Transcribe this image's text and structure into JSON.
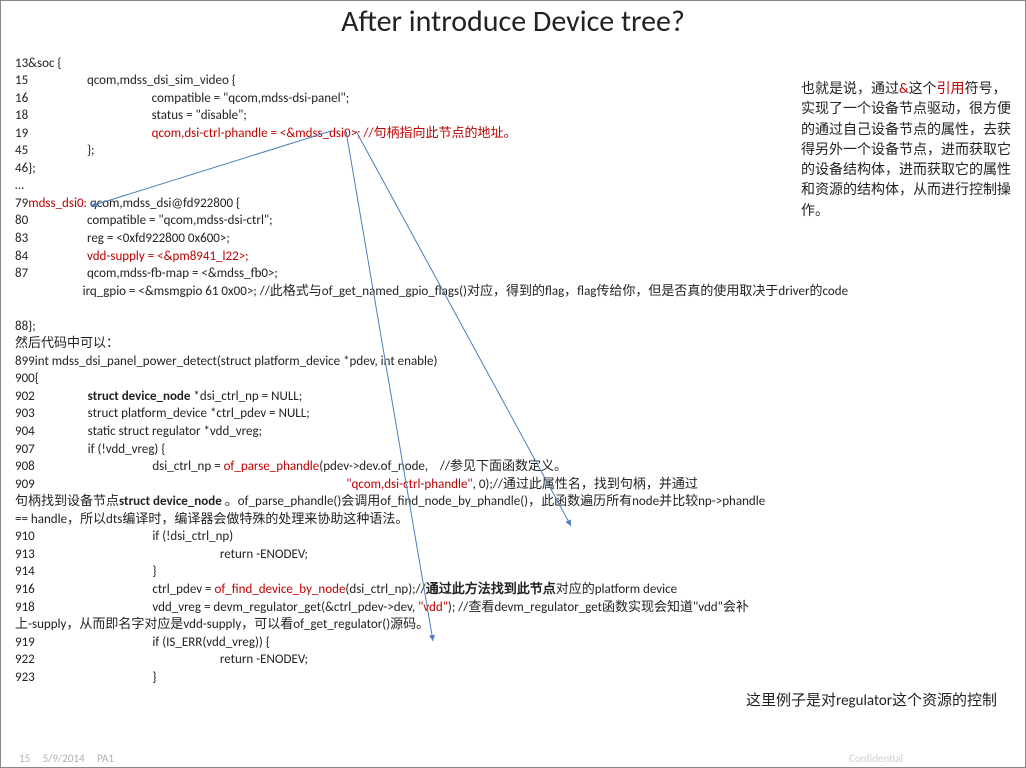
{
  "title": "After introduce Device tree?",
  "code": {
    "l13": "13&soc {",
    "l15": "15                    qcom,mdss_dsi_sim_video {",
    "l16": "16                                          compatible = \"qcom,mdss-dsi-panel\";",
    "l18": "18                                          status = \"disable\";",
    "l19pfx": "19                                          ",
    "l19red": "qcom,dsi-ctrl-phandle = <&mdss_dsi0>; //句柄指向此节点的地址。",
    "l45": "45                    };",
    "l46": "46};",
    "ldots": "…",
    "l79a": "79",
    "l79b": "mdss_dsi0:",
    "l79c": " qcom,mdss_dsi@fd922800 {",
    "l80": "80                    compatible = \"qcom,mdss-dsi-ctrl\";",
    "l83": "83                    reg = <0xfd922800 0x600>;",
    "l84a": "84                    ",
    "l84b": "vdd-supply = <&pm8941_l22>;",
    "l87": "87                    qcom,mdss-fb-map = <&mdss_fb0>;",
    "lirq": "                       irq_gpio = <&msmgpio 61 0x00>; //此格式与of_get_named_gpio_flags()对应，得到的flag，flag传给你，但是否真的使用取决于driver的code",
    "l88": "88};",
    "lthen": "然后代码中可以：",
    "l899": "899int mdss_dsi_panel_power_detect(struct platform_device *pdev, int enable)",
    "l900": "900{",
    "l902a": "902                  ",
    "l902b": "struct device_node",
    "l902c": " *dsi_ctrl_np = NULL;",
    "l903": "903                  struct platform_device *ctrl_pdev = NULL;",
    "l904": "904                  static struct regulator *vdd_vreg;",
    "l907": "907                  if (!vdd_vreg) {",
    "l908a": "908                                        dsi_ctrl_np = ",
    "l908b": "of_parse_phandle",
    "l908c": "(pdev->dev.of_node,    //参见下面函数定义。",
    "l909a": "909                                                                                                          ",
    "l909b": "\"qcom,dsi-ctrl-phandle\"",
    "l909c": ", 0);//通过此属性名，找到句柄，并通过",
    "lpara1a": "句柄找到设备节点",
    "lpara1b": "struct device_node ",
    "lpara1c": "。of_parse_phandle()会调用of_find_node_by_phandle()，此函数遍历所有node并比较np->phandle",
    "lpara2": "== handle，所以dts编译时，编译器会做特殊的处理来协助这种语法。",
    "l910": "910                                        if (!dsi_ctrl_np)",
    "l913": "913                                                               return -ENODEV;",
    "l914": "914                                        }",
    "l916a": "916                                        ctrl_pdev = ",
    "l916b": "of_find_device_by_node",
    "l916c": "(dsi_ctrl_np);//",
    "l916d": "通过此方法找到此节点",
    "l916e": "对应的platform device",
    "l918a": "918                                        vdd_vreg = devm_regulator_get(&ctrl_pdev->dev, ",
    "l918b": "\"vdd\"",
    "l918c": "); //查看devm_regulator_get函数实现会知道\"vdd\"会补",
    "lpara3": "上-supply，从而即名字对应是vdd-supply，可以看of_get_regulator()源码。",
    "l919": "919                                        if (IS_ERR(vdd_vreg)) {",
    "l922": "922                                                               return -ENODEV;",
    "l923": "923                                        }"
  },
  "sidenote": {
    "t1": "也就是说，通过",
    "t2": "&",
    "t3": "这个",
    "t4": "引用",
    "t5": "符号，实现了一个设备节点驱动，很方便的通过自己设备节点的属性，去获得另外一个设备节点，进而获取它的设备结构体，进而获取它的属性和资源的结构体，从而进行控制操作。"
  },
  "bottomnote": "这里例子是对regulator这个资源的控制",
  "footer": {
    "page": "15",
    "date": "5/9/2014",
    "id": "PA1",
    "conf": "Confidential"
  }
}
